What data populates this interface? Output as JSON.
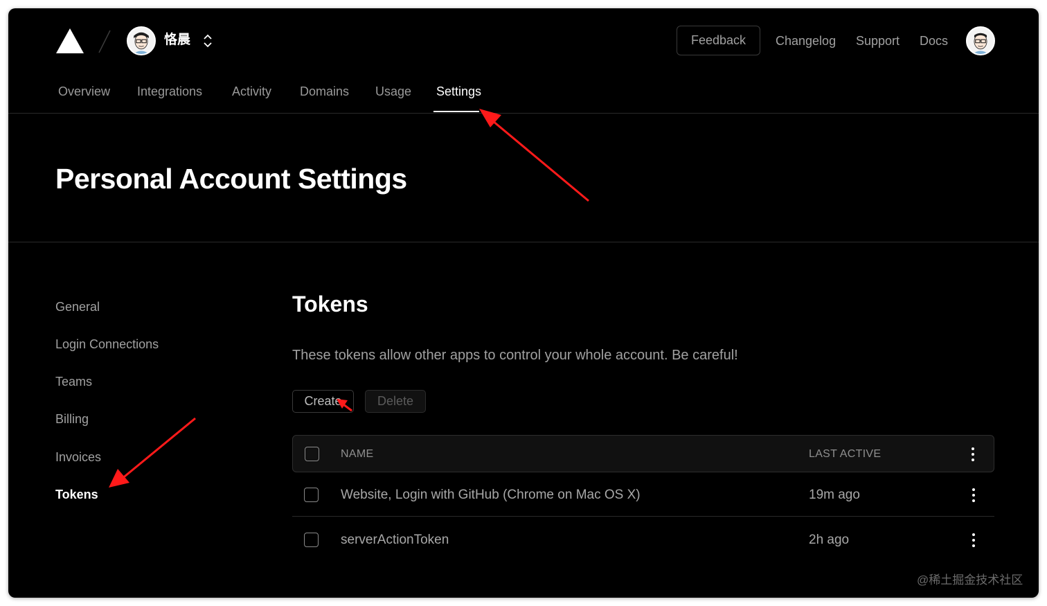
{
  "header": {
    "team_name": "恪晨",
    "feedback_label": "Feedback",
    "links": [
      "Changelog",
      "Support",
      "Docs"
    ]
  },
  "nav": {
    "tabs": [
      "Overview",
      "Integrations",
      "Activity",
      "Domains",
      "Usage",
      "Settings"
    ],
    "active_tab": "Settings"
  },
  "page": {
    "title": "Personal Account Settings"
  },
  "sidebar": {
    "items": [
      "General",
      "Login Connections",
      "Teams",
      "Billing",
      "Invoices",
      "Tokens"
    ],
    "active_item": "Tokens"
  },
  "tokens": {
    "title": "Tokens",
    "description": "These tokens allow other apps to control your whole account. Be careful!",
    "create_label": "Create",
    "delete_label": "Delete",
    "columns": [
      "NAME",
      "LAST ACTIVE"
    ],
    "rows": [
      {
        "name": "Website, Login with GitHub (Chrome on Mac OS X)",
        "last_active": "19m ago"
      },
      {
        "name": "serverActionToken",
        "last_active": "2h ago"
      }
    ]
  },
  "watermark": "@稀土掘金技术社区",
  "colors": {
    "background": "#000000",
    "text_primary": "#ffffff",
    "text_secondary": "#a1a1a1",
    "border": "#2e2e2e",
    "annotation_arrow": "#ff0000"
  }
}
